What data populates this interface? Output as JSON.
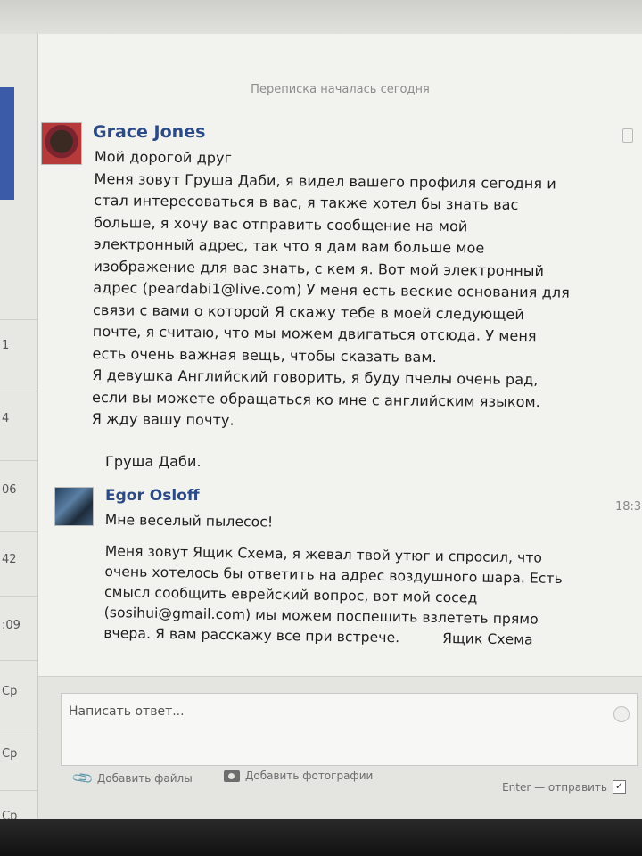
{
  "header": {
    "cut_title": ""
  },
  "conversation": {
    "started_label": "Переписка началась сегодня",
    "messages": [
      {
        "author": "Grace Jones",
        "lines": [
          "Мой дорогой друг",
          "Меня зовут Груша Даби, я видел вашего профиля сегодня и",
          "стал интересоваться в вас, я также хотел бы знать вас",
          "больше, я хочу вас отправить сообщение на мой",
          "электронный адрес, так что я дам вам больше мое",
          "изображение для вас знать, с кем я. Вот мой электронный",
          "адрес (peardabi1@live.com) У меня есть веские основания для",
          "связи с вами о которой Я скажу тебе в моей следующей",
          "почте, я считаю, что мы можем двигаться отсюда. У меня",
          "есть очень важная вещь, чтобы сказать вам.",
          "Я девушка Английский говорить, я буду пчелы очень рад,",
          "если вы можете обращаться ко мне с английским языком.",
          "Я жду вашу почту."
        ],
        "signature": "Груша Даби."
      },
      {
        "author": "Egor Osloff",
        "line1": "Мне веселый пылесос!",
        "lines": [
          "Меня зовут Ящик Схема, я жевал твой утюг и спросил, что",
          "очень хотелось бы ответить на адрес воздушного шара. Есть",
          "смысл сообщить еврейский вопрос, вот мой сосед",
          "(sosihui@gmail.com) мы можем поспешить взлететь прямо",
          "вчера. Я вам расскажу все при встрече."
        ],
        "signature": "Ящик Схема",
        "time": "18:3"
      }
    ]
  },
  "left_list": {
    "fragments": [
      "1",
      "4",
      "06",
      "42",
      ":09",
      "Ср",
      "Ср",
      "Ср"
    ]
  },
  "reply": {
    "placeholder": "Написать ответ...",
    "attach_label": "Добавить файлы",
    "photo_label": "Добавить фотографии",
    "enter_label": "Enter — отправить",
    "enter_checked": true
  },
  "colors": {
    "author_link": "#2b4a86",
    "accent_blue": "#3b5aa8"
  },
  "icons": [
    "paperclip-icon",
    "camera-icon",
    "checkbox-icon",
    "emoji-icon"
  ]
}
